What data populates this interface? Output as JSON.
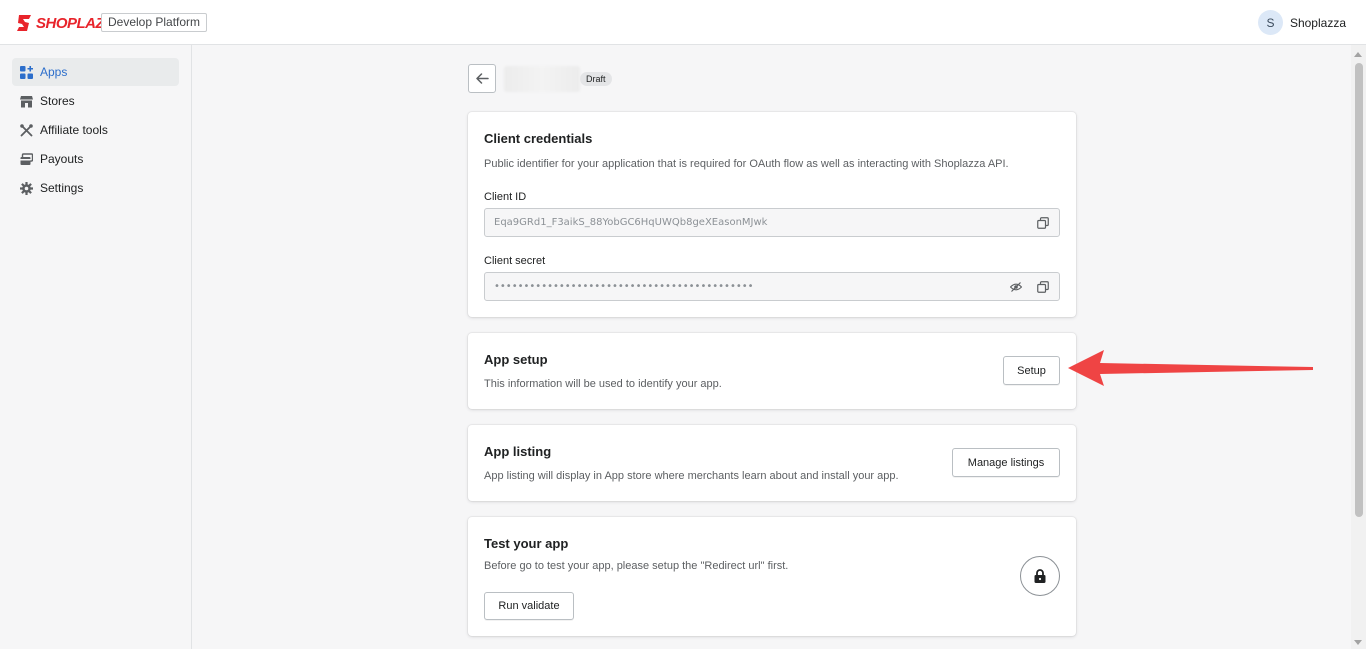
{
  "brand": {
    "logo_text": "SHOPLAZZA",
    "platform_tag": "Develop Platform",
    "color": "#e8242b"
  },
  "user": {
    "initial": "S",
    "name": "Shoplazza"
  },
  "sidebar": {
    "items": [
      {
        "label": "Apps",
        "icon": "apps-grid-icon",
        "active": true
      },
      {
        "label": "Stores",
        "icon": "store-icon",
        "active": false
      },
      {
        "label": "Affiliate tools",
        "icon": "tools-icon",
        "active": false
      },
      {
        "label": "Payouts",
        "icon": "payouts-icon",
        "active": false
      },
      {
        "label": "Settings",
        "icon": "gear-icon",
        "active": false
      }
    ]
  },
  "header": {
    "status_badge": "Draft"
  },
  "credentials": {
    "title": "Client credentials",
    "description": "Public identifier for your application that is required for OAuth flow as well as interacting with Shoplazza API.",
    "client_id_label": "Client ID",
    "client_id_value": "Eqa9GRd1_F3aikS_88YobGC6HqUWQb8geXEasonMJwk",
    "client_secret_label": "Client secret",
    "client_secret_value": "••••••••••••••••••••••••••••••••••••••••••••"
  },
  "app_setup": {
    "title": "App setup",
    "description": "This information will be used to identify your app.",
    "button": "Setup"
  },
  "app_listing": {
    "title": "App listing",
    "description": "App listing will display in App store where merchants learn about and install your app.",
    "button": "Manage listings"
  },
  "test_app": {
    "title": "Test your app",
    "description": "Before go to test your app, please setup the \"Redirect url\" first.",
    "button": "Run validate"
  },
  "colors": {
    "accent": "#2c6ecb",
    "annotation_arrow": "#ef4444"
  }
}
